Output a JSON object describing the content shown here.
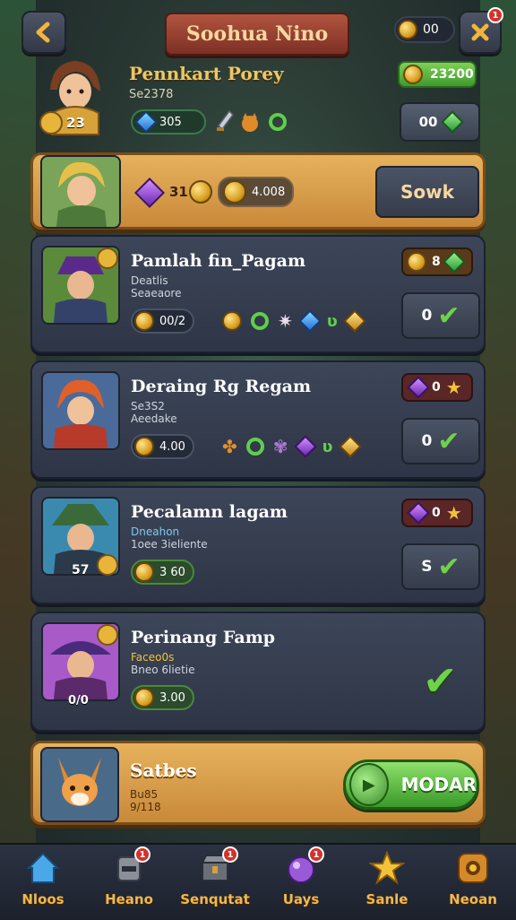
{
  "header": {
    "title": "Soohua Nino",
    "coin_value": "00"
  },
  "profile": {
    "name": "Pennkart Porey",
    "sub": "Se2378",
    "level": "23",
    "gems": "305",
    "bank": "23200",
    "claim_value": "00"
  },
  "featured": {
    "gem_count": "31",
    "coin_value": "4.008",
    "button_label": "Sowk"
  },
  "quests": [
    {
      "title": "Pamlah fin_Pagam",
      "sub1": "Deatlis",
      "sub2": "Seaeaore",
      "coins": "00/2",
      "reward_value": "8",
      "check_value": "0",
      "portrait_bg": "#5a8a3a"
    },
    {
      "title": "Deraing Rg Regam",
      "sub1": "Se3S2",
      "sub2": "Aeedake",
      "coins": "4.00",
      "reward_value": "0",
      "check_value": "0",
      "portrait_bg": "#4a6a9a"
    },
    {
      "title": "Pecalamn lagam",
      "sub1": "Dneahon",
      "sub2": "1oee 3ieliente",
      "coins": "3 60",
      "reward_value": "0",
      "check_value": "S",
      "level": "57",
      "portrait_bg": "#3a8ab0"
    },
    {
      "title": "Perinang Famp",
      "sub1": "Faceo0s",
      "sub2": "Bneo 6lietie",
      "coins": "3.00",
      "level": "0/0",
      "portrait_bg": "#a85ac8"
    }
  ],
  "status": {
    "title": "Satbes",
    "sub1": "Bu85",
    "sub2": "9/118",
    "button_label": "MODAR"
  },
  "nav": [
    {
      "label": "Nloos",
      "icon": "home-icon"
    },
    {
      "label": "Heano",
      "icon": "helmet-icon",
      "badge": "1"
    },
    {
      "label": "Senqutat",
      "icon": "chest-icon",
      "badge": "1"
    },
    {
      "label": "Uays",
      "icon": "orb-icon",
      "badge": "1"
    },
    {
      "label": "Sanle",
      "icon": "star-icon"
    },
    {
      "label": "Neoan",
      "icon": "settings-icon"
    }
  ]
}
